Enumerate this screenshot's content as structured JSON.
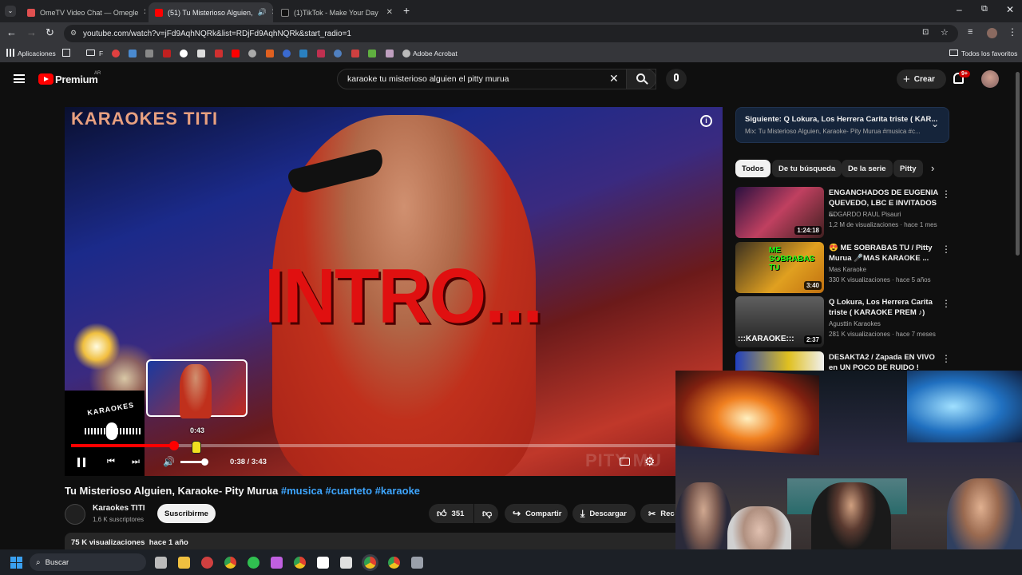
{
  "browser": {
    "tabs": [
      {
        "title": "OmeTV Video Chat — Omegle",
        "favicon_color": "#e05050",
        "active": false
      },
      {
        "title": "(51) Tu Misterioso Alguien,",
        "favicon_color": "#ff0000",
        "active": true
      },
      {
        "title": "(1)TikTok - Make Your Day",
        "favicon_color": "#ffffff",
        "active": false
      }
    ],
    "url": "youtube.com/watch?v=jFd9AqhNQRk&list=RDjFd9AqhNQRk&start_radio=1",
    "bookmarks": {
      "apps_label": "Aplicaciones",
      "folder_label": "F",
      "acrobat_label": "Adobe Acrobat",
      "all_favorites_label": "Todos los favoritos"
    }
  },
  "youtube": {
    "logo_text": "Premium",
    "region": "AR",
    "search_query": "karaoke tu misterioso alguien el pitty murua",
    "create_label": "Crear",
    "notifications_badge": "9+",
    "video": {
      "overlay_brand": "KARAOKES TITI",
      "overlay_text": "INTRO...",
      "bottom_watermark": "PITY MU",
      "karaoke_badge": "KARAOKES",
      "hover_time": "0:43",
      "current_time": "0:38 / 3:43",
      "progress": 0.17,
      "title_text": "Tu Misterioso Alguien, Karaoke- Pity Murua ",
      "hashtags": "#musica #cuarteto #karaoke"
    },
    "channel": {
      "name": "Karaokes TITI",
      "subscribers": "1,6 K suscriptores",
      "subscribe_label": "Suscribirme"
    },
    "actions": {
      "likes": "351",
      "share_label": "Compartir",
      "download_label": "Descargar",
      "clip_label": "Rec"
    },
    "description": {
      "views": "75 K visualizaciones",
      "date": "hace 1 año"
    },
    "up_next": {
      "title": "Siguiente: Q Lokura, Los Herrera Carita triste ( KAR...",
      "subtitle": "Mix: Tu Misterioso Alguien, Karaoke- Pity Murua #musica #c..."
    },
    "chips": [
      "Todos",
      "De tu búsqueda",
      "De la serie",
      "Pitty"
    ],
    "recommendations": [
      {
        "title": "ENGANCHADOS DE EUGENIA QUEVEDO, LBC E INVITADOS ...",
        "channel": "EDGARDO RAUL Pisauri",
        "stats": "1,2 M de visualizaciones · hace 1 mes",
        "duration": "1:24:18",
        "thumb_color": "#c04060"
      },
      {
        "title": "😍 ME SOBRABAS TU / Pitty Murua 🎤MAS KARAOKE ...",
        "channel": "Mas Karaoke",
        "stats": "330 K visualizaciones · hace 5 años",
        "duration": "3:40",
        "thumb_color": "#e0a020",
        "thumb_text": "ME SOBRABAS TU"
      },
      {
        "title": "Q Lokura, Los Herrera Carita triste ( KARAOKE PREM ♪)",
        "channel": "Agusttin Karaokes",
        "stats": "281 K visualizaciones · hace 7 meses",
        "duration": "2:37",
        "thumb_color": "#303030",
        "thumb_text": ":::KARAOKE:::"
      },
      {
        "title": "DESAKTA2 / Zapada EN VIVO en UN POCO DE RUIDO !",
        "channel": "",
        "stats": "",
        "duration": "",
        "thumb_color": "#e0c020"
      }
    ]
  },
  "taskbar": {
    "search_label": "Buscar"
  }
}
